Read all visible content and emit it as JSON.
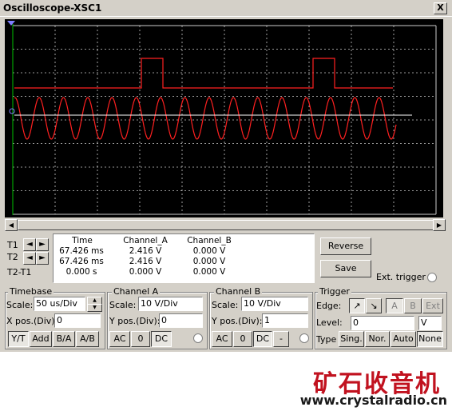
{
  "window": {
    "title": "Oscilloscope-XSC1",
    "close_label": "X"
  },
  "colors": {
    "trace_a": "#e00000",
    "trace_b": "#ffffff",
    "grid": "#ffffff",
    "screen_bg": "#000000",
    "brand_red": "#c1121f"
  },
  "cursors": {
    "t1_label": "T1",
    "t2_label": "T2",
    "diff_label": "T2-T1"
  },
  "readout": {
    "headers": [
      "Time",
      "Channel_A",
      "Channel_B"
    ],
    "rows": [
      [
        "67.426 ms",
        "2.416 V",
        "0.000 V"
      ],
      [
        "67.426 ms",
        "2.416 V",
        "0.000 V"
      ],
      [
        "0.000 s",
        "0.000 V",
        "0.000 V"
      ]
    ]
  },
  "buttons": {
    "reverse": "Reverse",
    "save": "Save",
    "ext_trigger": "Ext. trigger"
  },
  "timebase": {
    "title": "Timebase",
    "scale_label": "Scale:",
    "scale_value": "50 us/Div",
    "xpos_label": "X pos.(Div):",
    "xpos_value": "0",
    "modes": [
      "Y/T",
      "Add",
      "B/A",
      "A/B"
    ]
  },
  "channel_a": {
    "title": "Channel A",
    "scale_label": "Scale:",
    "scale_value": "10  V/Div",
    "ypos_label": "Y pos.(Div):",
    "ypos_value": "0",
    "coupling": [
      "AC",
      "0",
      "DC"
    ]
  },
  "channel_b": {
    "title": "Channel B",
    "scale_label": "Scale:",
    "scale_value": "10  V/Div",
    "ypos_label": "Y pos.(Div):",
    "ypos_value": "1",
    "coupling": [
      "AC",
      "0",
      "DC",
      "-"
    ]
  },
  "trigger": {
    "title": "Trigger",
    "edge_label": "Edge:",
    "level_label": "Level:",
    "level_value": "0",
    "level_unit": "V",
    "sources": [
      "A",
      "B",
      "Ext"
    ],
    "type_label": "Type",
    "types": [
      "Sing.",
      "Nor.",
      "Auto",
      "None"
    ]
  },
  "brand": {
    "name": "矿石收音机",
    "url": "www.crystalradio.cn"
  }
}
